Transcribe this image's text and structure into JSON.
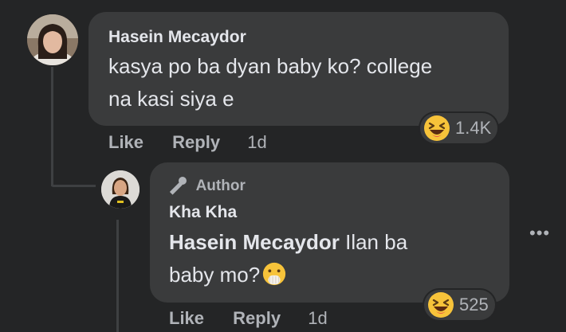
{
  "comment": {
    "author": "Hasein Mecaydor",
    "text_line1": "kasya po ba dyan baby ko? college",
    "text_line2": "na kasi siya e",
    "like_label": "Like",
    "reply_label": "Reply",
    "time": "1d",
    "reaction_count": "1.4K",
    "reaction_icon": "laughing-emoji"
  },
  "reply": {
    "badge": "Author",
    "author": "Kha Kha",
    "mention": "Hasein Mecaydor",
    "text_after_mention": " Ilan ba",
    "text_line2": "baby mo?",
    "inline_emoji": "face-with-hand-over-mouth",
    "like_label": "Like",
    "reply_label": "Reply",
    "time": "1d",
    "reaction_count": "525",
    "reaction_icon": "laughing-emoji"
  },
  "more_options": "•••",
  "colors": {
    "background": "#242526",
    "bubble": "#3a3b3c",
    "text_primary": "#e4e6eb",
    "text_secondary": "#b0b3b8"
  }
}
